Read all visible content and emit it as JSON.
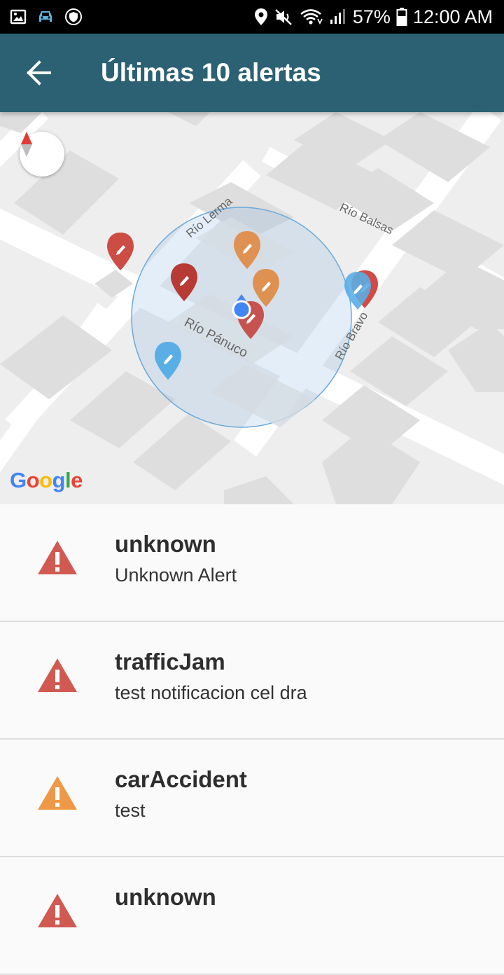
{
  "status_bar": {
    "battery": "57%",
    "time": "12:00 AM"
  },
  "app_bar": {
    "title": "Últimas 10 alertas"
  },
  "map": {
    "streets": [
      "Río Lerma",
      "Río Balsas",
      "Río Pánuco",
      "Río Bravo"
    ],
    "attribution": "Google"
  },
  "alerts": [
    {
      "title": "unknown",
      "subtitle": "Unknown Alert",
      "color": "#d05a52"
    },
    {
      "title": "trafficJam",
      "subtitle": "test notificacion cel dra",
      "color": "#d05a52"
    },
    {
      "title": "carAccident",
      "subtitle": "test",
      "color": "#ef9848"
    },
    {
      "title": "unknown",
      "subtitle": "",
      "color": "#d05a52"
    }
  ]
}
